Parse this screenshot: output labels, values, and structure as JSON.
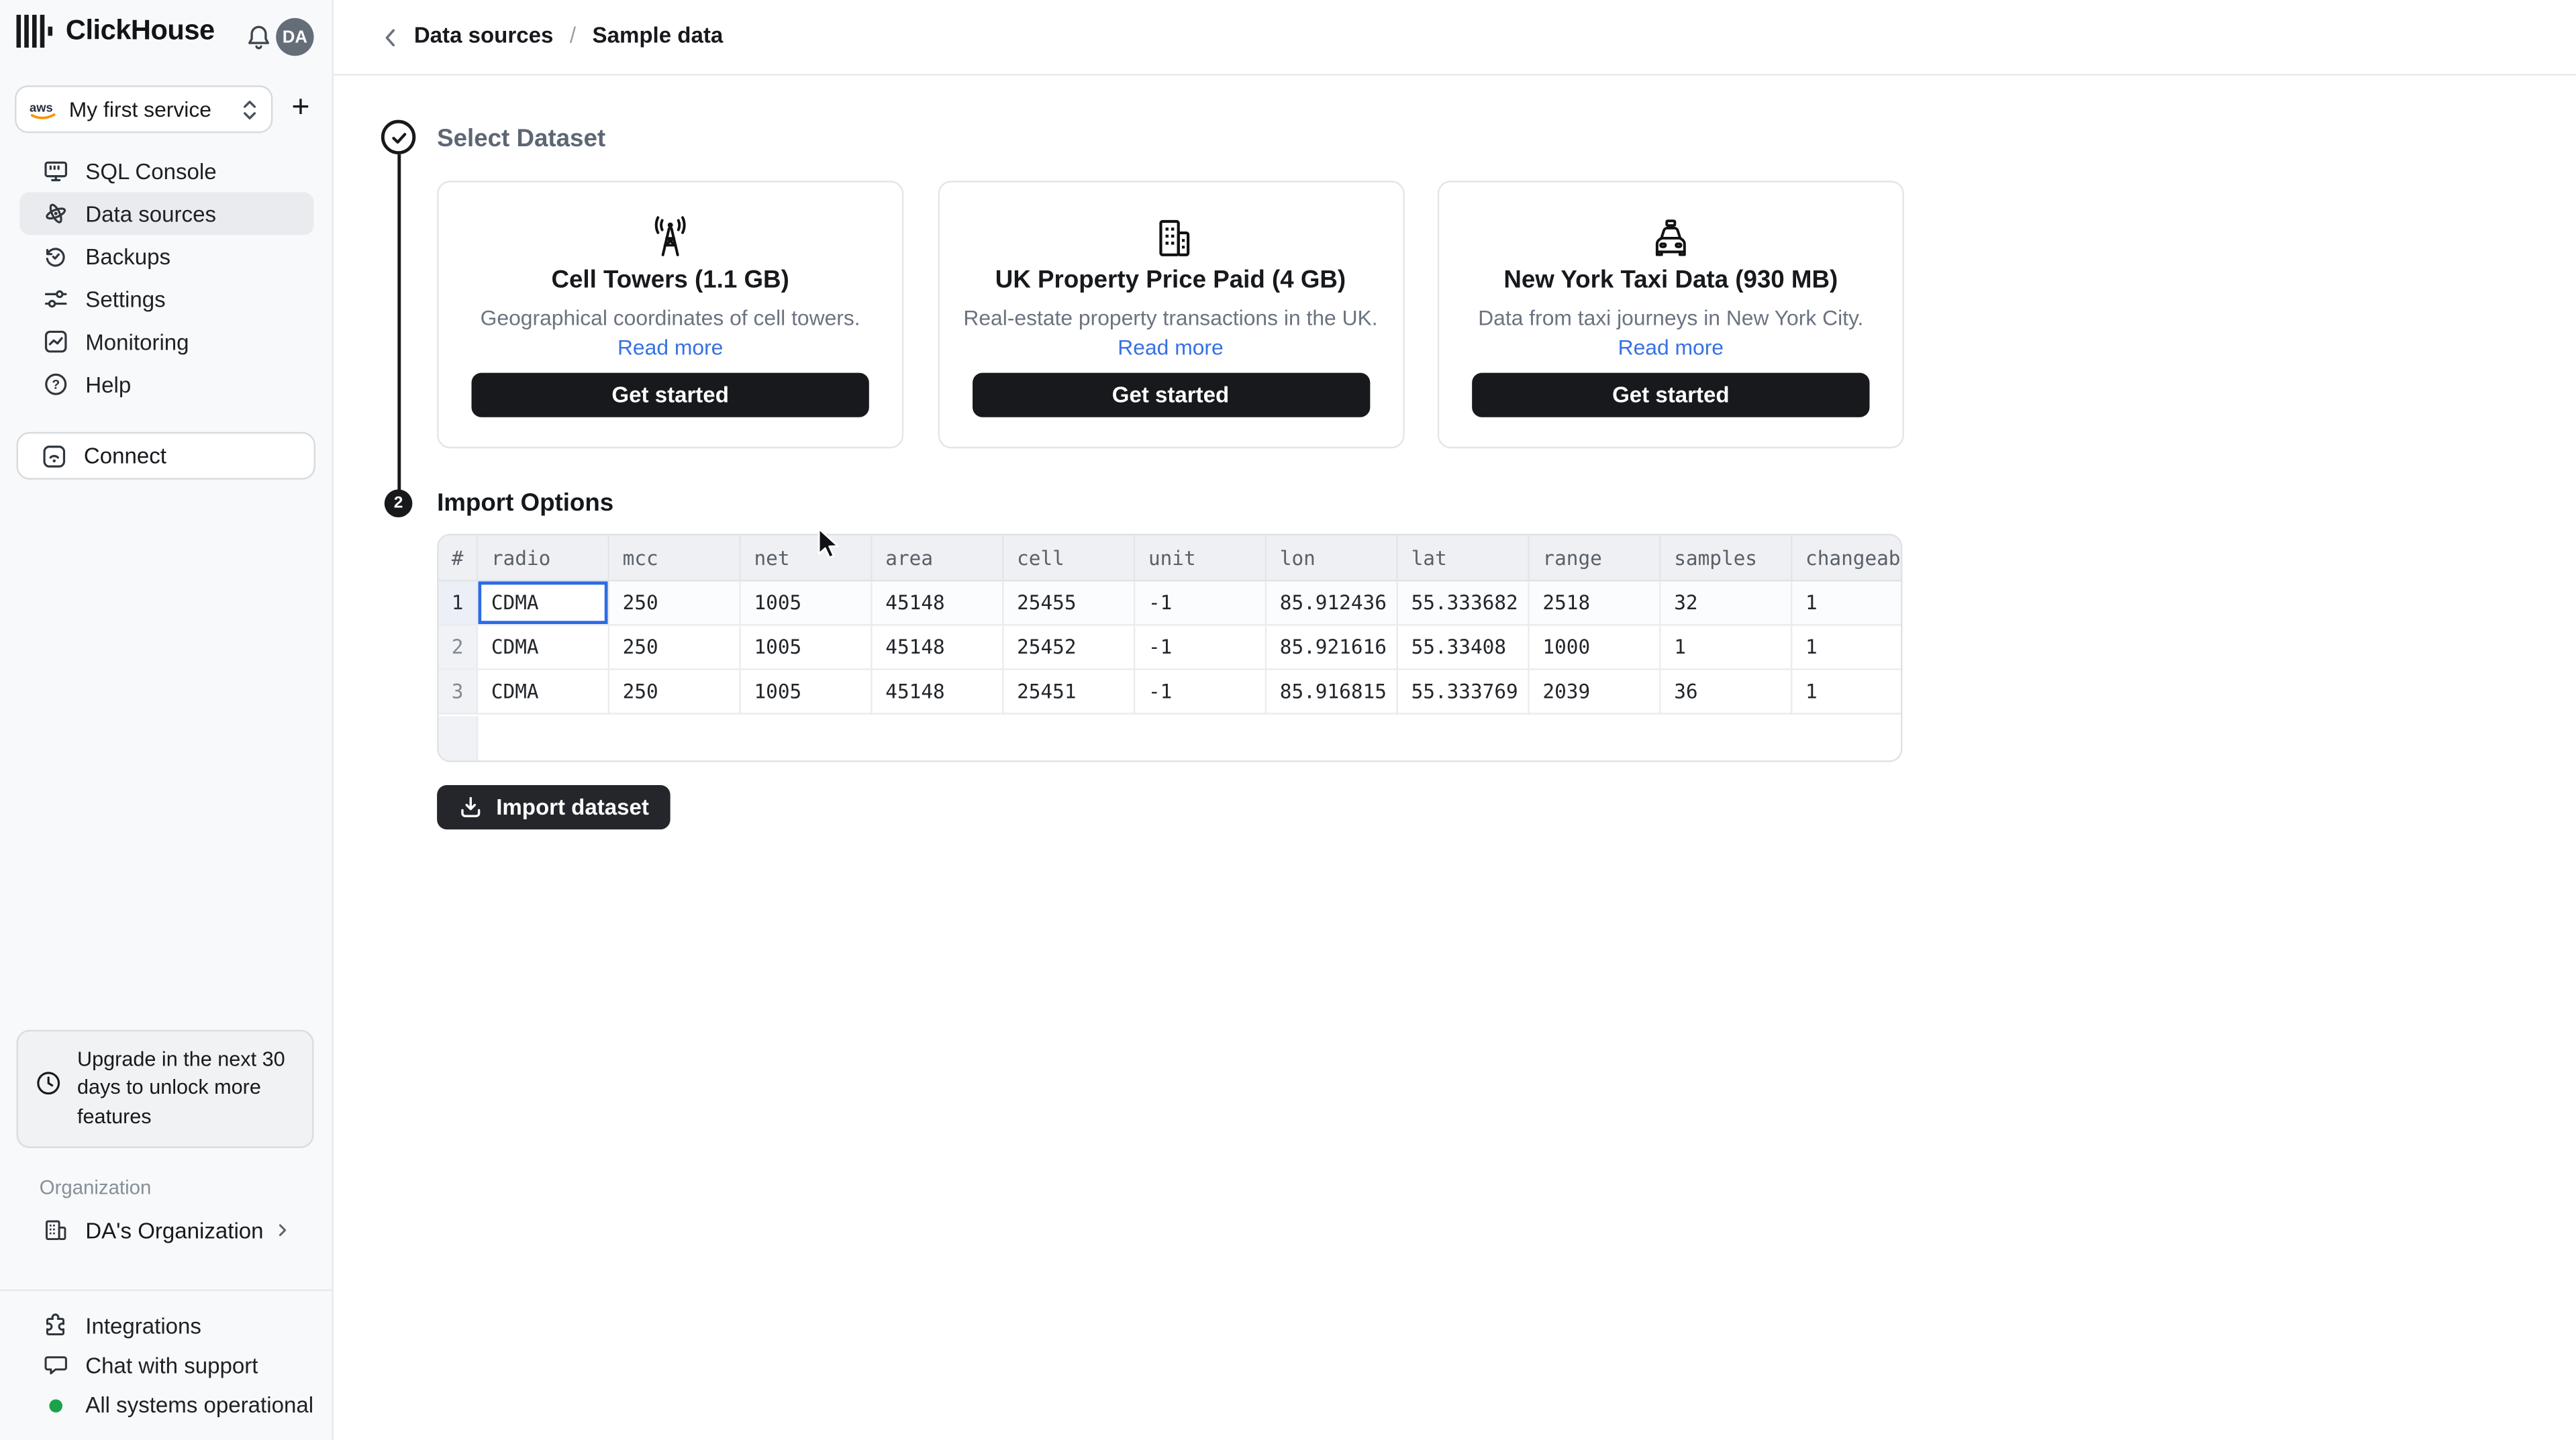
{
  "app": {
    "brand": "ClickHouse",
    "avatar_initials": "DA"
  },
  "sidebar": {
    "service_selector": {
      "label": "My first service",
      "provider_icon": "aws-icon"
    },
    "nav": [
      {
        "label": "SQL Console",
        "icon": "sql-console-icon",
        "active": false
      },
      {
        "label": "Data sources",
        "icon": "data-sources-icon",
        "active": true
      },
      {
        "label": "Backups",
        "icon": "backups-icon",
        "active": false
      },
      {
        "label": "Settings",
        "icon": "settings-icon",
        "active": false
      },
      {
        "label": "Monitoring",
        "icon": "monitoring-icon",
        "active": false
      },
      {
        "label": "Help",
        "icon": "help-icon",
        "active": false
      }
    ],
    "connect_label": "Connect",
    "upgrade_notice": "Upgrade in the next 30 days to unlock more features",
    "organization_label": "Organization",
    "organization_name": "DA's Organization",
    "footer": [
      {
        "label": "Integrations",
        "icon": "puzzle-icon"
      },
      {
        "label": "Chat with support",
        "icon": "chat-icon"
      },
      {
        "label": "All systems operational",
        "icon": "status-dot"
      }
    ]
  },
  "breadcrumb": {
    "items": [
      "Data sources",
      "Sample data"
    ],
    "separator": "/"
  },
  "steps": {
    "step1_title": "Select Dataset",
    "step2_number": "2",
    "step2_title": "Import Options"
  },
  "datasets": [
    {
      "icon": "cell-tower-icon",
      "title": "Cell Towers (1.1 GB)",
      "description": "Geographical coordinates of cell towers.",
      "read_more": "Read more",
      "cta": "Get started"
    },
    {
      "icon": "building-icon",
      "title": "UK Property Price Paid (4 GB)",
      "description": "Real-estate property transactions in the UK.",
      "read_more": "Read more",
      "cta": "Get started"
    },
    {
      "icon": "taxi-icon",
      "title": "New York Taxi Data (930 MB)",
      "description": "Data from taxi journeys in New York City.",
      "read_more": "Read more",
      "cta": "Get started"
    }
  ],
  "preview_table": {
    "columns": [
      "#",
      "radio",
      "mcc",
      "net",
      "area",
      "cell",
      "unit",
      "lon",
      "lat",
      "range",
      "samples",
      "changeable"
    ],
    "rows": [
      [
        "1",
        "CDMA",
        "250",
        "1005",
        "45148",
        "25455",
        "-1",
        "85.912436",
        "55.333682",
        "2518",
        "32",
        "1"
      ],
      [
        "2",
        "CDMA",
        "250",
        "1005",
        "45148",
        "25452",
        "-1",
        "85.921616",
        "55.33408",
        "1000",
        "1",
        "1"
      ],
      [
        "3",
        "CDMA",
        "250",
        "1005",
        "45148",
        "25451",
        "-1",
        "85.916815",
        "55.333769",
        "2039",
        "36",
        "1"
      ]
    ],
    "selected_cell": {
      "row": 0,
      "col": 1
    }
  },
  "import_button": {
    "label": "Import dataset"
  },
  "colors": {
    "accent_link_blue": "#3671e3",
    "selection_blue": "#2c6be5",
    "status_green": "#1aa34a",
    "dark": "#17191c",
    "sidebar_bg": "#f8f9fa",
    "table_header_bg": "#eef0f3"
  }
}
